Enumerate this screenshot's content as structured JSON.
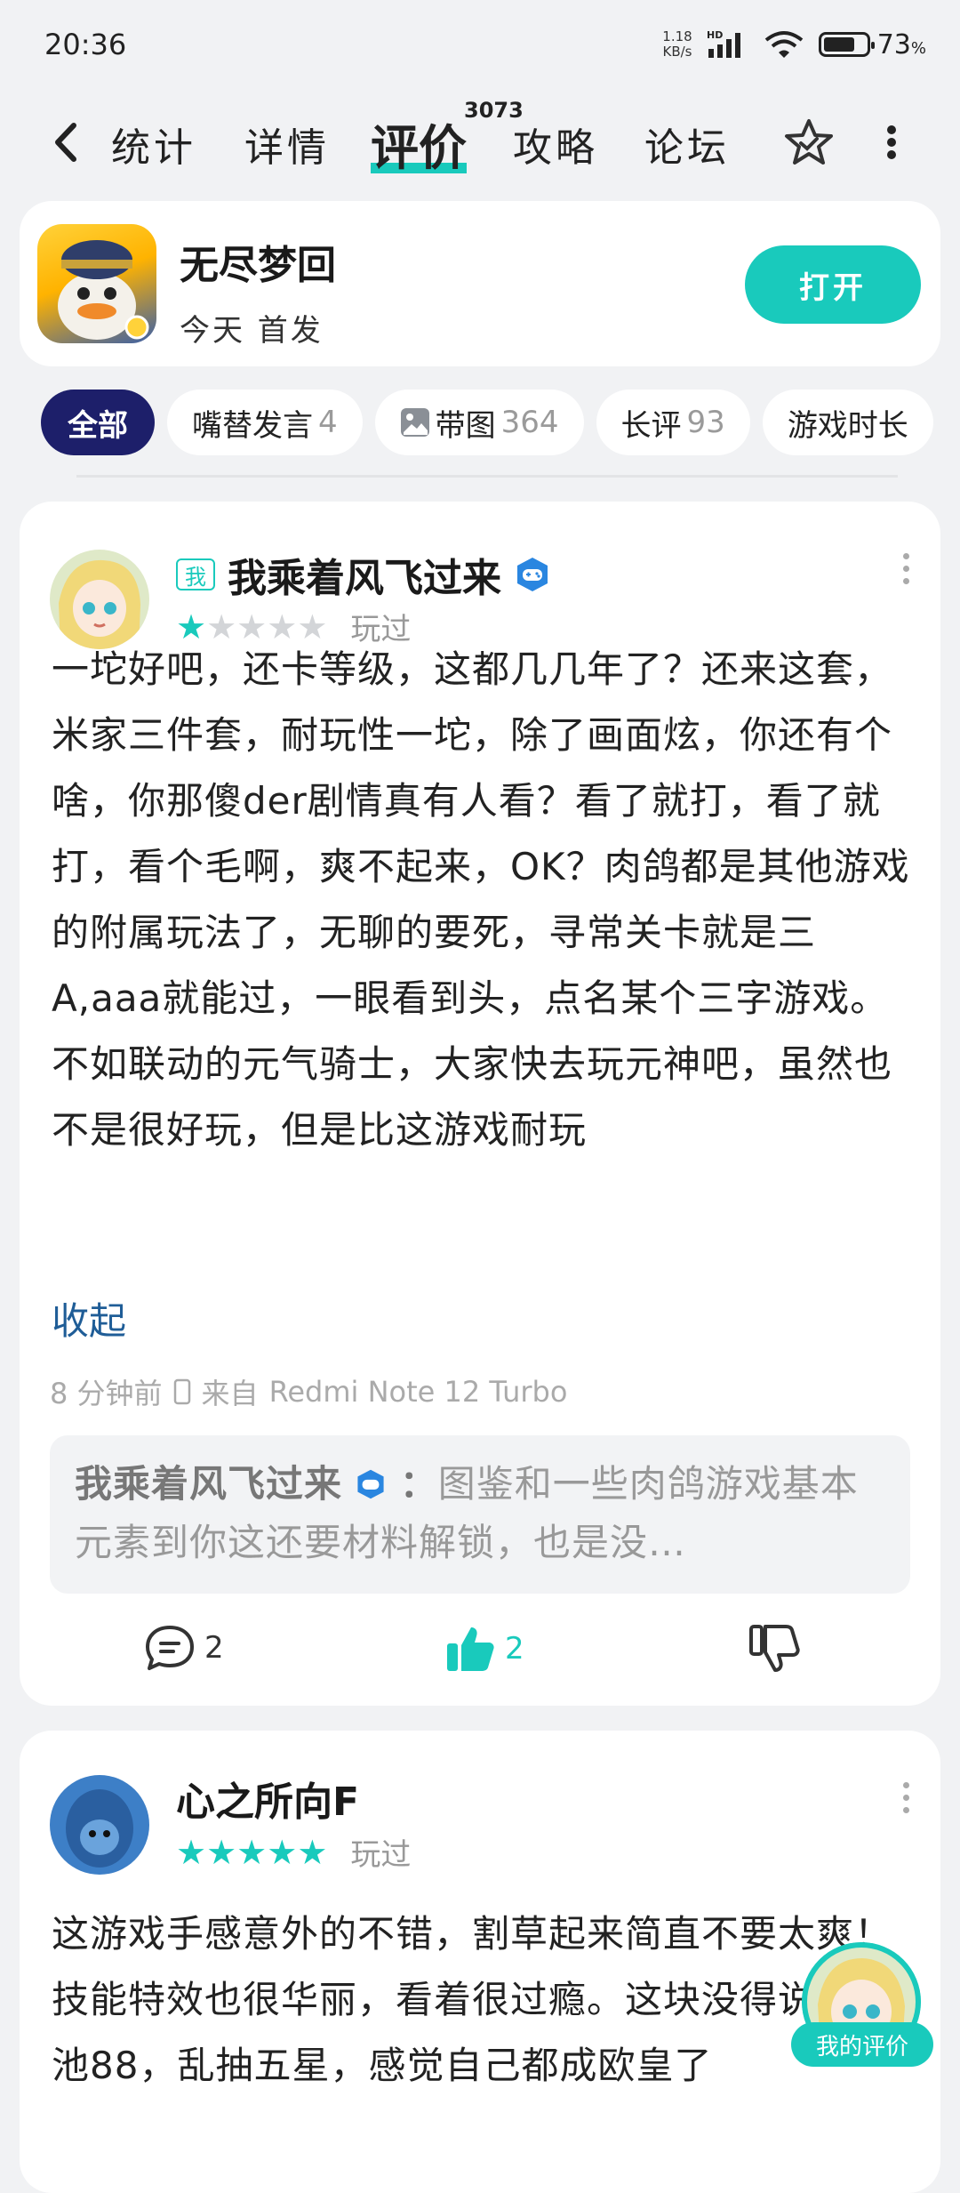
{
  "status_bar": {
    "time": "20:36",
    "net_speed_value": "1.18",
    "net_speed_unit": "KB/s",
    "hd": "HD",
    "battery": "73",
    "battery_unit": "%"
  },
  "nav": {
    "tabs": [
      "统计",
      "详情",
      "评价",
      "攻略",
      "论坛"
    ],
    "active_tab": "评价",
    "review_count": "3073"
  },
  "app": {
    "title": "无尽梦回",
    "subtitle": "今天 首发",
    "open_label": "打开"
  },
  "filters": [
    {
      "label": "全部",
      "count": ""
    },
    {
      "label": "嘴替发言",
      "count": "4"
    },
    {
      "label": "带图",
      "count": "364"
    },
    {
      "label": "长评",
      "count": "93"
    },
    {
      "label": "游戏时长",
      "count": ""
    }
  ],
  "reviews": [
    {
      "me_tag": "我",
      "name": "我乘着风飞过来",
      "rating": 1,
      "played": "玩过",
      "body": "一坨好吧，还卡等级，这都几几年了？还来这套，米家三件套，耐玩性一坨，除了画面炫，你还有个啥，你那傻der剧情真有人看？看了就打，看了就打，看个毛啊，爽不起来，OK？肉鸽都是其他游戏的附属玩法了，无聊的要死，寻常关卡就是三A,aaa就能过，一眼看到头，点名某个三字游戏。不如联动的元气骑士，大家快去玩元神吧，虽然也不是很好玩，但是比这游戏耐玩",
      "collapse": "收起",
      "time": "8 分钟前",
      "device_prefix": "来自",
      "device": "Redmi Note 12 Turbo",
      "reply_name": "我乘着风飞过来",
      "reply_sep": "：",
      "reply_text": "图鉴和一些肉鸽游戏基本元素到你这还要材料解锁，也是没…",
      "comments": "2",
      "likes": "2"
    },
    {
      "name": "心之所向F",
      "rating": 5,
      "played": "玩过",
      "body": "这游戏手感意外的不错，割草起来简直不要太爽！技能特效也很华丽，看着很过瘾。这块没得说，米池88，乱抽五星，感觉自己都成欧皇了"
    }
  ],
  "fab": {
    "label": "我的评价"
  },
  "colors": {
    "accent": "#19cabc",
    "filter_active": "#1d1f6a",
    "link": "#1f5d97"
  }
}
